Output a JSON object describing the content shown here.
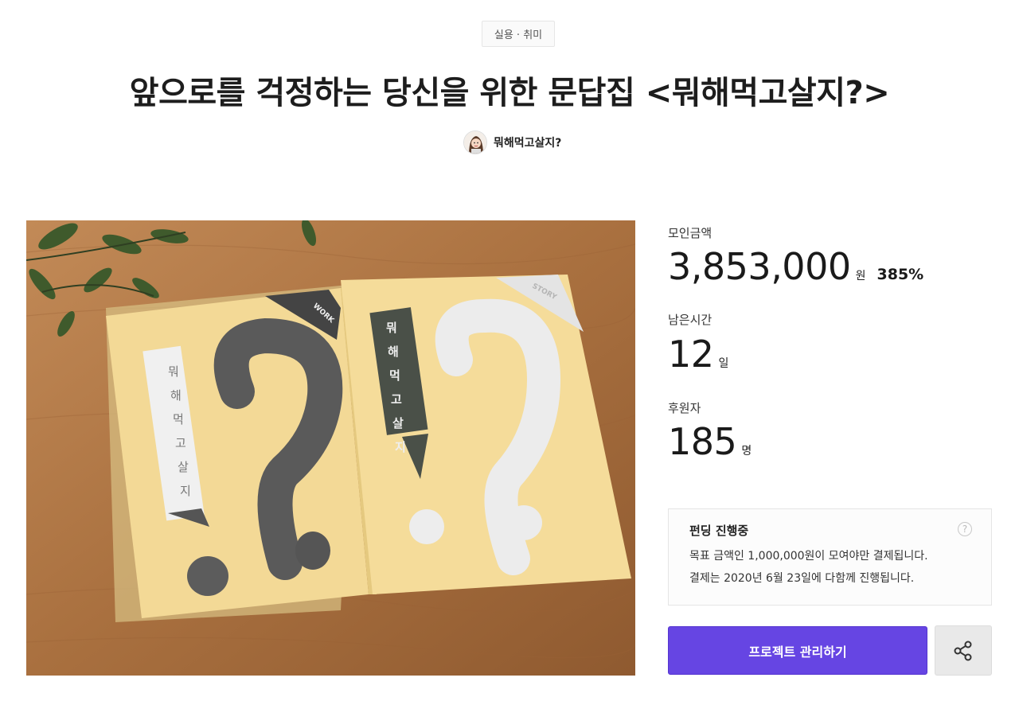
{
  "category": "실용 · 취미",
  "title": "앞으로를 걱정하는 당신을 위한 문답집 <뭐해먹고살지?>",
  "creator": {
    "name": "뭐해먹고살지?",
    "avatar_icon": "avatar-icon"
  },
  "hero": {
    "left_page": {
      "label": "WORK",
      "vertical_text": "뭐해먹고살지"
    },
    "right_page": {
      "label": "STORY",
      "vertical_text": "뭐해먹고살지"
    }
  },
  "stats": {
    "amount": {
      "label": "모인금액",
      "value": "3,853,000",
      "unit": "원",
      "percent": "385%"
    },
    "time": {
      "label": "남은시간",
      "value": "12",
      "unit": "일"
    },
    "backers": {
      "label": "후원자",
      "value": "185",
      "unit": "명"
    }
  },
  "status": {
    "title": "펀딩 진행중",
    "help_icon": "help-icon",
    "line1": "목표 금액인 1,000,000원이 모여야만 결제됩니다.",
    "line2": "결제는 2020년 6월 23일에 다함께 진행됩니다."
  },
  "actions": {
    "manage_label": "프로젝트 관리하기",
    "share_icon": "share-icon"
  },
  "colors": {
    "accent": "#6645e3",
    "book": "#f3d996",
    "wood": "#b0794a"
  }
}
